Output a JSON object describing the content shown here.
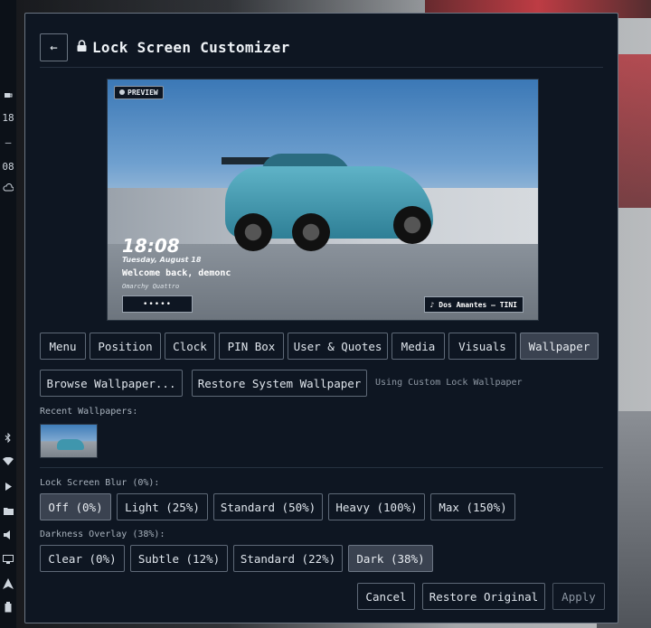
{
  "sidebar": {
    "items": [
      "18",
      "—",
      "08"
    ]
  },
  "dialog": {
    "back_icon": "←",
    "title": "Lock Screen Customizer"
  },
  "preview": {
    "badge": "PREVIEW",
    "clock": "18:08",
    "date": "Tuesday, August 18",
    "welcome": "Welcome back, demonc",
    "subtitle": "Omarchy Quattro",
    "pin": "•••••",
    "media": "♪ Dos Amantes — TINI"
  },
  "tabs": [
    {
      "label": "Menu"
    },
    {
      "label": "Position"
    },
    {
      "label": "Clock"
    },
    {
      "label": "PIN Box"
    },
    {
      "label": "User & Quotes"
    },
    {
      "label": "Media"
    },
    {
      "label": "Visuals"
    },
    {
      "label": "Wallpaper",
      "active": true
    }
  ],
  "wallpaper": {
    "browse_label": "Browse Wallpaper...",
    "restore_label": "Restore System Wallpaper",
    "status": "Using Custom Lock Wallpaper",
    "recent_label": "Recent Wallpapers:"
  },
  "blur": {
    "label": "Lock Screen Blur (0%):",
    "options": [
      "Off (0%)",
      "Light (25%)",
      "Standard (50%)",
      "Heavy (100%)",
      "Max (150%)"
    ],
    "selected": "Off (0%)"
  },
  "darkness": {
    "label": "Darkness Overlay (38%):",
    "options": [
      "Clear (0%)",
      "Subtle (12%)",
      "Standard (22%)",
      "Dark (38%)"
    ],
    "selected": "Dark (38%)"
  },
  "footer": {
    "cancel": "Cancel",
    "restore_original": "Restore Original",
    "apply": "Apply"
  },
  "colors": {
    "dialog_bg": "#0e1622",
    "border": "#5e6977",
    "active_bg": "#3a4250"
  }
}
